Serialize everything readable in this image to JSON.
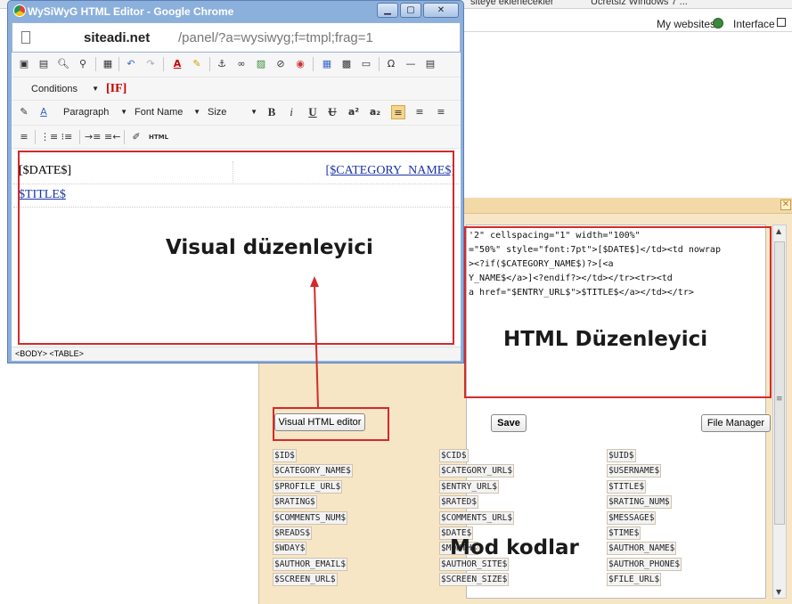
{
  "bg": {
    "bookmarks": [
      "siteye eklenecekler",
      "Ücretsiz Windows 7 ..."
    ],
    "nav_links": [
      "My websites",
      "Interface"
    ]
  },
  "popup": {
    "title": "WySiWyG HTML Editor - Google Chrome",
    "address_host": "siteadi.net",
    "address_path": "/panel/?a=wysiwyg;f=tmpl;frag=1",
    "conditions_label": "Conditions",
    "if_label": "[IF]",
    "paragraph": "Paragraph",
    "font_name": "Font Name",
    "size": "Size",
    "design": {
      "date": "[$DATE$]",
      "category": "[$CATEGORY_NAME$]",
      "title": "$TITLE$"
    },
    "status": "<BODY> <TABLE>"
  },
  "editor": {
    "code_lines": [
      "'2\" cellspacing=\"1\" width=\"100%\"",
      "=\"50%\" style=\"font:7pt\">[$DATE$]</td><td nowrap",
      "><?if($CATEGORY_NAME$)?>[<a",
      "Y_NAME$</a>]<?endif?></td></tr><tr><td",
      "a href=\"$ENTRY_URL$\">$TITLE$</a></td></tr>"
    ],
    "visual_button": "Visual HTML editor",
    "save_button": "Save",
    "file_manager_button": "File Manager",
    "codes": {
      "col1": [
        "$ID$",
        "$CATEGORY_NAME$",
        "$PROFILE_URL$",
        "$RATING$",
        "$COMMENTS_NUM$",
        "$READS$",
        "$WDAY$",
        "$AUTHOR_EMAIL$",
        "$SCREEN_URL$"
      ],
      "col2": [
        "$CID$",
        "$CATEGORY_URL$",
        "$ENTRY_URL$",
        "$RATED$",
        "$COMMENTS_URL$",
        "$DATE$",
        "$MONTH$",
        "$AUTHOR_SITE$",
        "$SCREEN_SIZE$"
      ],
      "col3": [
        "$UID$",
        "$USERNAME$",
        "$TITLE$",
        "$RATING_NUM$",
        "$MESSAGE$",
        "$TIME$",
        "$AUTHOR_NAME$",
        "$AUTHOR_PHONE$",
        "$FILE_URL$"
      ]
    }
  },
  "annotations": {
    "visual": "Visual düzenleyici",
    "html": "HTML Düzenleyici",
    "mod": "Mod kodlar"
  },
  "colors": {
    "annotation_red": "#d42a2a",
    "panel_bg": "#f7e6c6",
    "window_frame": "#8cb0dc"
  }
}
